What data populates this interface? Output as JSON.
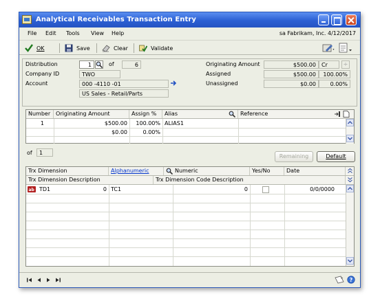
{
  "window": {
    "title": "Analytical Receivables Transaction Entry"
  },
  "menu": {
    "file": "File",
    "edit": "Edit",
    "tools": "Tools",
    "view": "View",
    "help": "Help",
    "user_info": "sa  Fabrikam, Inc.  4/12/2017"
  },
  "toolbar": {
    "ok": "OK",
    "save": "Save",
    "clear": "Clear",
    "validate": "Validate"
  },
  "header": {
    "distribution_label": "Distribution",
    "distribution_value": "1",
    "of_label": "of",
    "distribution_total": "6",
    "company_label": "Company ID",
    "company_value": "TWO",
    "account_label": "Account",
    "account_value": "000 -4110 -01",
    "account_desc": "US Sales - Retail/Parts",
    "originating_amount_label": "Originating Amount",
    "originating_amount_value": "$500.00",
    "crdr": "Cr",
    "assigned_label": "Assigned",
    "assigned_value": "$500.00",
    "assigned_pct": "100.00%",
    "unassigned_label": "Unassigned",
    "unassigned_value": "$0.00",
    "unassigned_pct": "0.00%"
  },
  "alias_grid": {
    "columns": {
      "number": "Number",
      "originating_amount": "Originating Amount",
      "assign_pct": "Assign %",
      "alias": "Alias",
      "reference": "Reference"
    },
    "rows": [
      {
        "number": "1",
        "amount": "$500.00",
        "pct": "100.00%",
        "alias": "ALIAS1",
        "reference": ""
      },
      {
        "number": "",
        "amount": "$0.00",
        "pct": "0.00%",
        "alias": "",
        "reference": ""
      }
    ],
    "footer_of": "of",
    "footer_count": "1",
    "remaining_button": "Remaining",
    "default_button": "Default"
  },
  "dim_grid": {
    "columns": {
      "trx_dimension": "Trx Dimension",
      "alphanumeric": "Alphanumeric",
      "numeric": "Numeric",
      "yes_no": "Yes/No",
      "date": "Date",
      "dim_desc": "Trx Dimension Description",
      "code_desc": "Trx Dimension Code Description"
    },
    "rows": [
      {
        "dimension": "TD1",
        "num_value": "0",
        "code": "TC1",
        "numeric": "0",
        "date": "0/0/0000"
      }
    ]
  },
  "colors": {
    "title_bar": "#2b5fd3",
    "window_bg": "#eceee4",
    "link": "#0033cc"
  }
}
